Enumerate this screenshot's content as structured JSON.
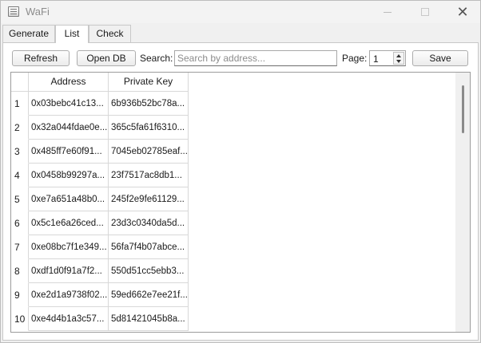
{
  "window": {
    "title": "WaFi"
  },
  "tabs": [
    {
      "label": "Generate",
      "active": false
    },
    {
      "label": "List",
      "active": true
    },
    {
      "label": "Check",
      "active": false
    }
  ],
  "toolbar": {
    "refresh_label": "Refresh",
    "opendb_label": "Open DB",
    "search_label": "Search:",
    "search_placeholder": "Search by address...",
    "search_value": "",
    "page_label": "Page:",
    "page_value": "1",
    "save_label": "Save"
  },
  "table": {
    "columns": [
      "Address",
      "Private Key"
    ],
    "rows": [
      {
        "num": "1",
        "address": "0x03bebc41c13...",
        "key": "6b936b52bc78a..."
      },
      {
        "num": "2",
        "address": "0x32a044fdae0e...",
        "key": "365c5fa61f6310..."
      },
      {
        "num": "3",
        "address": "0x485ff7e60f91...",
        "key": "7045eb02785eaf..."
      },
      {
        "num": "4",
        "address": "0x0458b99297a...",
        "key": "23f7517ac8db1..."
      },
      {
        "num": "5",
        "address": "0xe7a651a48b0...",
        "key": "245f2e9fe61129..."
      },
      {
        "num": "6",
        "address": "0x5c1e6a26ced...",
        "key": "23d3c0340da5d..."
      },
      {
        "num": "7",
        "address": "0xe08bc7f1e349...",
        "key": "56fa7f4b07abce..."
      },
      {
        "num": "8",
        "address": "0xdf1d0f91a7f2...",
        "key": "550d51cc5ebb3..."
      },
      {
        "num": "9",
        "address": "0xe2d1a9738f02...",
        "key": "59ed662e7ee21f..."
      },
      {
        "num": "10",
        "address": "0xe4d4b1a3c57...",
        "key": "5d81421045b8a..."
      }
    ]
  },
  "icons": {
    "app": "app-icon",
    "minimize": "minimize-icon",
    "maximize": "maximize-icon",
    "close": "close-icon"
  }
}
